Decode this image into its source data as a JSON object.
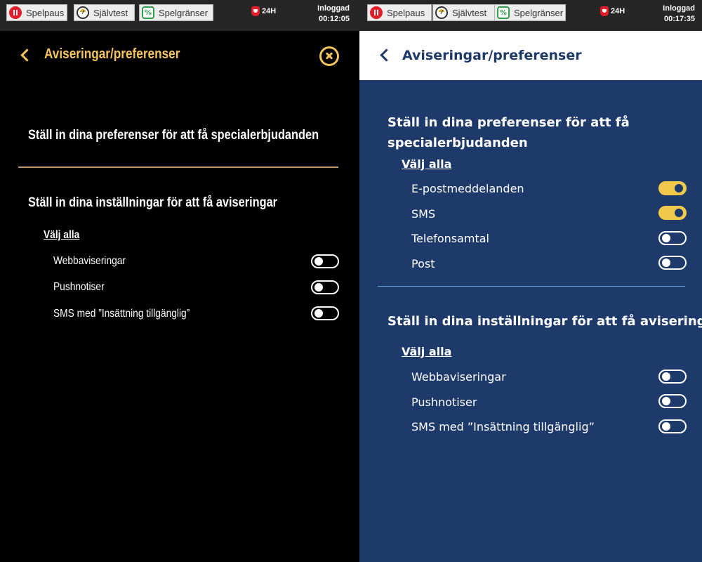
{
  "topbar": {
    "pause_label": "Spelpaus",
    "selftest_label": "Självtest",
    "limits_label": "Spelgränser",
    "h24_label": "24H",
    "login_label": "Inloggad"
  },
  "left": {
    "session_time": "00:12:05",
    "title": "Aviseringar/preferenser",
    "offers_title": "Ställ in dina preferenser för att få specialerbjudanden",
    "notifications_title": "Ställ in dina inställningar för att få aviseringar",
    "select_all": "Välj alla",
    "items": [
      {
        "label": "Webbaviseringar",
        "on": false
      },
      {
        "label": "Pushnotiser",
        "on": false
      },
      {
        "label": "SMS med ”Insättning tillgänglig”",
        "on": false
      }
    ],
    "colors": {
      "accent": "#f3c45a",
      "background": "#000000",
      "divider": "#b89a6a"
    }
  },
  "right": {
    "session_time": "00:17:35",
    "title": "Aviseringar/preferenser",
    "offers_title_line1": "Ställ in dina preferenser för att få",
    "offers_title_line2": "specialerbjudanden",
    "offers_select_all": "Välj alla",
    "offers_items": [
      {
        "label": "E-postmeddelanden",
        "on": true
      },
      {
        "label": "SMS",
        "on": true
      },
      {
        "label": "Telefonsamtal",
        "on": false
      },
      {
        "label": "Post",
        "on": false
      }
    ],
    "notifications_title": "Ställ in dina inställningar för att få aviseringar",
    "notifications_select_all": "Välj alla",
    "notifications_items": [
      {
        "label": "Webbaviseringar",
        "on": false
      },
      {
        "label": "Pushnotiser",
        "on": false
      },
      {
        "label": "SMS med ”Insättning tillgänglig”",
        "on": false
      }
    ],
    "colors": {
      "background": "#1e3a6b",
      "toggle_on": "#f1c94a",
      "divider": "#6aa5d8"
    }
  }
}
